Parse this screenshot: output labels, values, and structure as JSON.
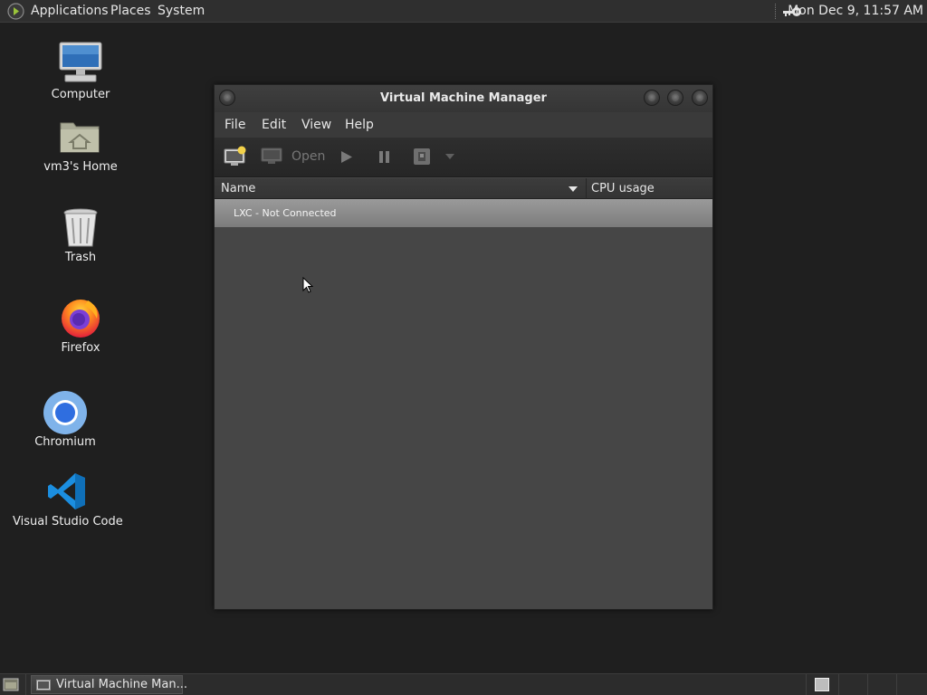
{
  "top_panel": {
    "menus": [
      "Applications",
      "Places",
      "System"
    ],
    "clock": "Mon Dec  9, 11:57 AM",
    "logo_icon": "distro-logo-icon",
    "tray_icon": "key-icon"
  },
  "desktop": {
    "icons": [
      {
        "label": "Computer",
        "icon": "computer-icon"
      },
      {
        "label": "vm3's Home",
        "icon": "home-folder-icon"
      },
      {
        "label": "Trash",
        "icon": "trash-icon"
      },
      {
        "label": "Firefox",
        "icon": "firefox-icon"
      },
      {
        "label": "Chromium",
        "icon": "chromium-icon"
      },
      {
        "label": "Visual Studio Code",
        "icon": "vscode-icon"
      }
    ]
  },
  "window": {
    "title": "Virtual Machine Manager",
    "menu": [
      "File",
      "Edit",
      "View",
      "Help"
    ],
    "toolbar": {
      "new_vm_icon": "new-vm-icon",
      "open_label": "Open",
      "run_icon": "play-icon",
      "pause_icon": "pause-icon",
      "shutdown_icon": "shutdown-icon"
    },
    "columns": [
      "Name",
      "CPU usage"
    ],
    "rows": [
      {
        "name": "LXC - Not Connected"
      }
    ]
  },
  "taskbar": {
    "tasks": [
      {
        "label": "Virtual Machine Man...",
        "icon": "virt-manager-icon"
      }
    ]
  },
  "colors": {
    "desktop_bg": "#1f1f1f",
    "panel_bg": "#2f2f2f",
    "window_bg": "#474747",
    "selected_row": "#8a8a8a"
  }
}
